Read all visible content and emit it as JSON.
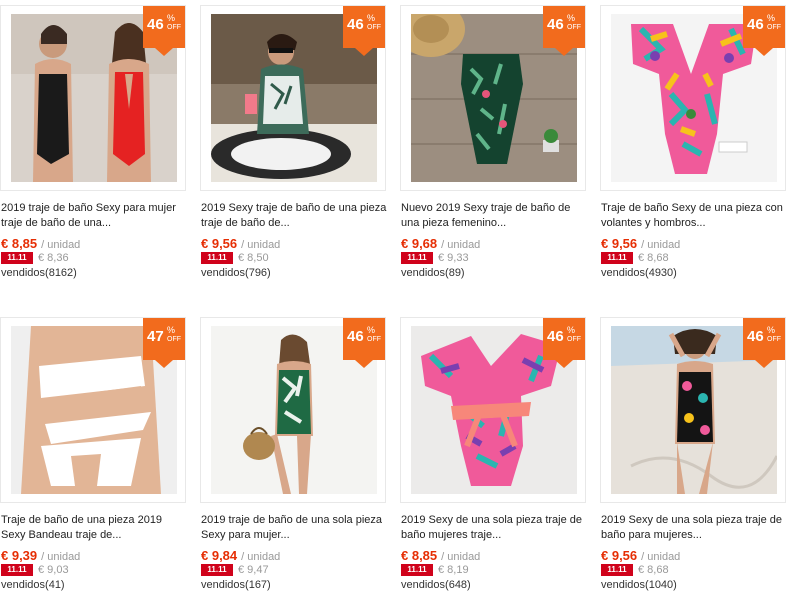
{
  "products": [
    {
      "discount": "46",
      "pct": "%",
      "off": "OFF",
      "title": "2019 traje de baño Sexy para mujer traje de baño de una...",
      "price": "€ 8,85",
      "unit": "/ unidad",
      "promo_tag": "11.11",
      "promo_price": "€ 8,36",
      "sold": "vendidos(8162)",
      "photo": "two-models-black-red"
    },
    {
      "discount": "46",
      "pct": "%",
      "off": "OFF",
      "title": "2019 Sexy traje de baño de una pieza traje de baño de...",
      "price": "€ 9,56",
      "unit": "/ unidad",
      "promo_tag": "11.11",
      "promo_price": "€ 8,50",
      "sold": "vendidos(796)",
      "photo": "model-sitting-patterned"
    },
    {
      "discount": "46",
      "pct": "%",
      "off": "OFF",
      "title": "Nuevo 2019 Sexy traje de baño de una pieza femenino...",
      "price": "€ 9,68",
      "unit": "/ unidad",
      "promo_tag": "11.11",
      "promo_price": "€ 9,33",
      "sold": "vendidos(89)",
      "photo": "green-leaf-flatlay"
    },
    {
      "discount": "46",
      "pct": "%",
      "off": "OFF",
      "title": "Traje de baño Sexy de una pieza con volantes y hombros...",
      "price": "€ 9,56",
      "unit": "/ unidad",
      "promo_tag": "11.11",
      "promo_price": "€ 8,68",
      "sold": "vendidos(4930)",
      "photo": "floral-ruffle-flatlay"
    },
    {
      "discount": "47",
      "pct": "%",
      "off": "OFF",
      "title": "Traje de baño de una pieza 2019 Sexy Bandeau traje de...",
      "price": "€ 9,39",
      "unit": "/ unidad",
      "promo_tag": "11.11",
      "promo_price": "€ 9,03",
      "sold": "vendidos(41)",
      "photo": "white-bandeau"
    },
    {
      "discount": "46",
      "pct": "%",
      "off": "OFF",
      "title": "2019 traje de baño de una sola pieza Sexy para mujer...",
      "price": "€ 9,84",
      "unit": "/ unidad",
      "promo_tag": "11.11",
      "promo_price": "€ 9,47",
      "sold": "vendidos(167)",
      "photo": "green-leaf-model"
    },
    {
      "discount": "46",
      "pct": "%",
      "off": "OFF",
      "title": "2019 Sexy de una sola pieza traje de baño mujeres traje...",
      "price": "€ 8,85",
      "unit": "/ unidad",
      "promo_tag": "11.11",
      "promo_price": "€ 8,19",
      "sold": "vendidos(648)",
      "photo": "floral-bow-flatlay"
    },
    {
      "discount": "46",
      "pct": "%",
      "off": "OFF",
      "title": "2019 Sexy de una sola pieza traje de baño para mujeres...",
      "price": "€ 9,56",
      "unit": "/ unidad",
      "promo_tag": "11.11",
      "promo_price": "€ 8,68",
      "sold": "vendidos(1040)",
      "photo": "beach-model-floral"
    }
  ],
  "colors": {
    "badge": "#f26b1d",
    "price": "#e62e04",
    "promo_tag": "#d0021b"
  }
}
